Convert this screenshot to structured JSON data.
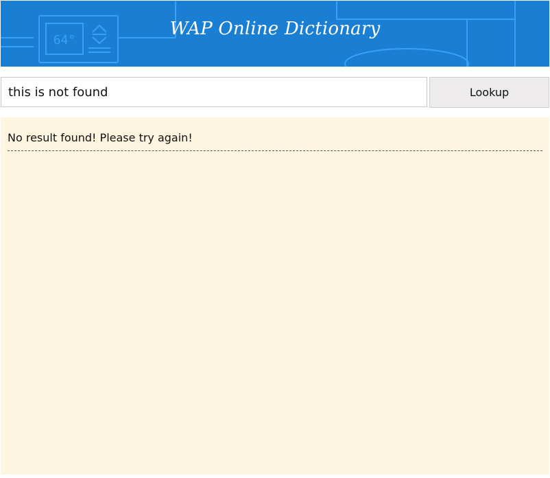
{
  "header": {
    "title": "WAP Online Dictionary",
    "thermostat_reading": "64°",
    "background_color": "#1a7fd3",
    "decor_icon": "thermostat-icon"
  },
  "search": {
    "value": "this is not found",
    "lookup_label": "Lookup"
  },
  "results": {
    "message": "No result found! Please try again!",
    "background_color": "#fdf5e0"
  }
}
